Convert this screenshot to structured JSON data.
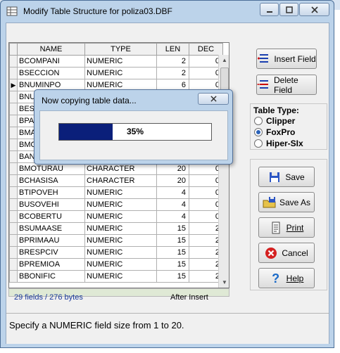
{
  "window": {
    "title": "Modify Table Structure for poliza03.DBF"
  },
  "grid": {
    "columns": [
      "NAME",
      "TYPE",
      "LEN",
      "DEC"
    ],
    "current_row": 2,
    "rows": [
      {
        "name": "BCOMPANI",
        "type": "NUMERIC",
        "len": "2",
        "dec": "0"
      },
      {
        "name": "BSECCION",
        "type": "NUMERIC",
        "len": "2",
        "dec": "0"
      },
      {
        "name": "BNUMINPO",
        "type": "NUMERIC",
        "len": "6",
        "dec": "0"
      },
      {
        "name": "BNU",
        "type": "",
        "len": "",
        "dec": ""
      },
      {
        "name": "BES",
        "type": "",
        "len": "",
        "dec": ""
      },
      {
        "name": "BPA",
        "type": "",
        "len": "",
        "dec": ""
      },
      {
        "name": "BMA",
        "type": "",
        "len": "",
        "dec": ""
      },
      {
        "name": "BMO",
        "type": "",
        "len": "",
        "dec": ""
      },
      {
        "name": "BAN",
        "type": "",
        "len": "",
        "dec": ""
      },
      {
        "name": "BMOTURAU",
        "type": "CHARACTER",
        "len": "20",
        "dec": "0"
      },
      {
        "name": "BCHASISA",
        "type": "CHARACTER",
        "len": "20",
        "dec": "0"
      },
      {
        "name": "BTIPOVEH",
        "type": "NUMERIC",
        "len": "4",
        "dec": "0"
      },
      {
        "name": "BUSOVEHI",
        "type": "NUMERIC",
        "len": "4",
        "dec": "0"
      },
      {
        "name": "BCOBERTU",
        "type": "NUMERIC",
        "len": "4",
        "dec": "0"
      },
      {
        "name": "BSUMAASE",
        "type": "NUMERIC",
        "len": "15",
        "dec": "2"
      },
      {
        "name": "BPRIMAAU",
        "type": "NUMERIC",
        "len": "15",
        "dec": "2"
      },
      {
        "name": "BRESPCIV",
        "type": "NUMERIC",
        "len": "15",
        "dec": "2"
      },
      {
        "name": "BPREMIOA",
        "type": "NUMERIC",
        "len": "15",
        "dec": "2"
      },
      {
        "name": "BBONIFIC",
        "type": "NUMERIC",
        "len": "15",
        "dec": "2"
      }
    ]
  },
  "status": {
    "fields": "29 fields  / 276 bytes",
    "mode": "After Insert"
  },
  "hint": "Specify a NUMERIC field size from 1 to 20.",
  "buttons": {
    "insert_field": "Insert Field",
    "delete_field": "Delete Field",
    "save": "Save",
    "save_as": "Save As",
    "print": "Print",
    "cancel": "Cancel",
    "help": "Help"
  },
  "table_type": {
    "label": "Table Type:",
    "options": [
      "Clipper",
      "FoxPro",
      "Hiper-SIx"
    ],
    "selected": "FoxPro"
  },
  "progress_dialog": {
    "title": "Now copying table data...",
    "percent": 35,
    "label": "35%"
  }
}
